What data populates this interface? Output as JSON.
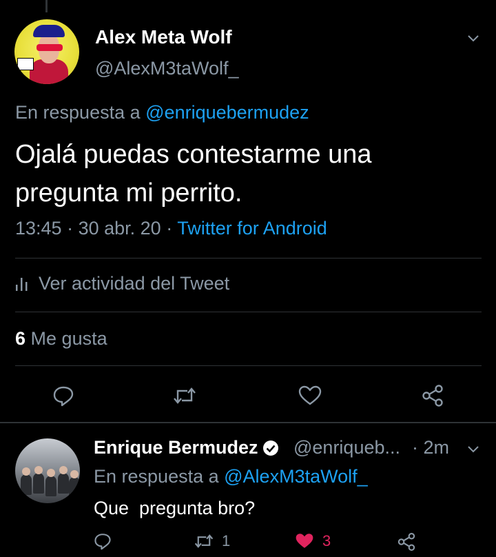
{
  "main_tweet": {
    "display_name": "Alex Meta Wolf",
    "handle": "@AlexM3taWolf_",
    "reply_prefix": "En respuesta a",
    "reply_to": "@enriquebermudez",
    "text": "Ojalá puedas contestarme una pregunta mi perrito.",
    "time": "13:45",
    "sep1": " · ",
    "date": "30 abr. 20",
    "sep2": " · ",
    "source": "Twitter for Android",
    "activity_label": "Ver actividad del Tweet",
    "likes_count": "6",
    "likes_label": "Me gusta",
    "icons": [
      "reply-icon",
      "retweet-icon",
      "like-icon",
      "share-icon",
      "chevron-down-icon",
      "activity-icon"
    ]
  },
  "reply_tweet": {
    "display_name": "Enrique Bermudez",
    "handle": "@enriqueb...",
    "time": "· 2m",
    "reply_prefix": "En respuesta a",
    "reply_to": "@AlexM3taWolf_",
    "text": "Que  pregunta bro?",
    "retweet_count": "1",
    "like_count": "3"
  },
  "colors": {
    "background": "#000000",
    "text_primary": "#ffffff",
    "text_secondary": "#8b98a5",
    "link": "#1da1f2",
    "like": "#e0245e",
    "divider": "#2f3336"
  }
}
